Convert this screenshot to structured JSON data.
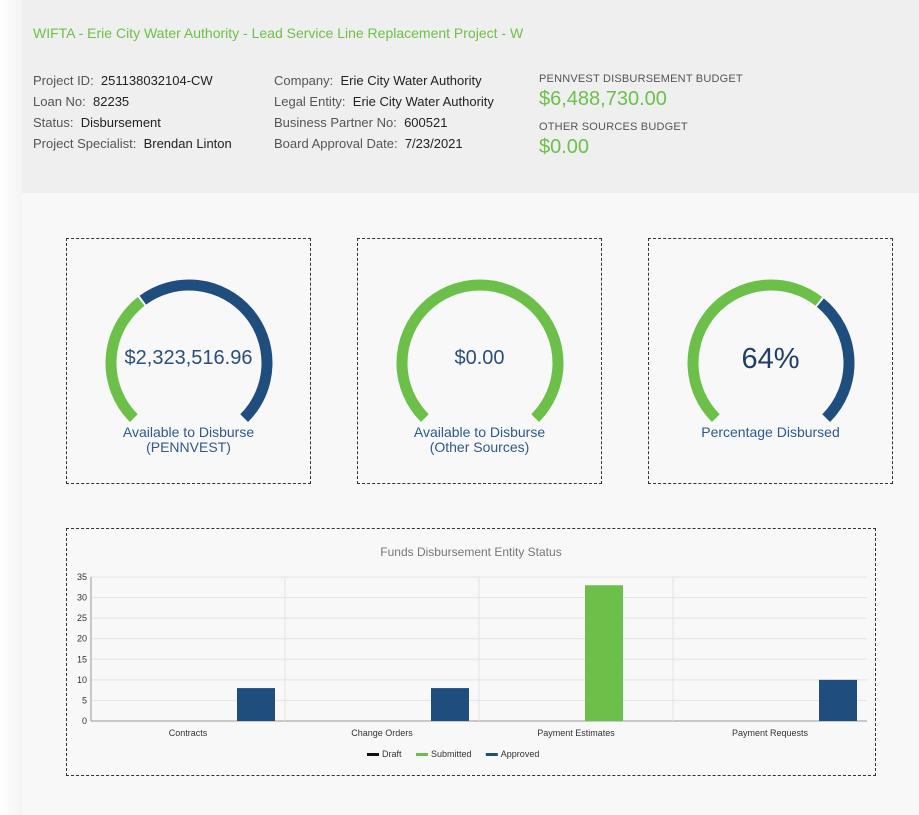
{
  "project": {
    "title": "WIFTA - Erie City Water Authority - Lead Service Line Replacement Project - W",
    "col1": [
      {
        "label": "Project ID:",
        "value": "251138032104-CW"
      },
      {
        "label": "Loan No:",
        "value": "82235"
      },
      {
        "label": "Status:",
        "value": "Disbursement"
      },
      {
        "label": "Project Specialist:",
        "value": "Brendan Linton"
      }
    ],
    "col2": [
      {
        "label": "Company:",
        "value": "Erie City Water Authority"
      },
      {
        "label": "Legal Entity:",
        "value": "Erie City Water Authority"
      },
      {
        "label": "Business Partner No:",
        "value": "600521"
      },
      {
        "label": "Board Approval Date:",
        "value": "7/23/2021"
      }
    ],
    "budgets": {
      "pennvest_label": "PENNVEST DISBURSEMENT BUDGET",
      "pennvest_value": "$6,488,730.00",
      "other_label": "OTHER SOURCES BUDGET",
      "other_value": "$0.00"
    }
  },
  "gauges": [
    {
      "value": "$2,323,516.96",
      "caption_line1": "Available to Disburse",
      "caption_line2": "(PENNVEST)",
      "fraction": 0.36
    },
    {
      "value": "$0.00",
      "caption_line1": "Available to Disburse",
      "caption_line2": "(Other Sources)",
      "fraction": 1.0
    },
    {
      "value": "64%",
      "caption_line1": "Percentage Disbursed",
      "caption_line2": "",
      "fraction": 0.64
    }
  ],
  "colors": {
    "green": "#6cc04a",
    "navy": "#1f4e7e",
    "draft": "#111111"
  },
  "chart_data": {
    "type": "bar",
    "title": "Funds Disbursement Entity Status",
    "categories": [
      "Contracts",
      "Change Orders",
      "Payment Estimates",
      "Payment Requests"
    ],
    "series": [
      {
        "name": "Draft",
        "values": [
          0,
          0,
          0,
          0
        ],
        "color": "#111111"
      },
      {
        "name": "Submitted",
        "values": [
          0,
          0,
          33,
          0
        ],
        "color": "#6cc04a"
      },
      {
        "name": "Approved",
        "values": [
          8,
          8,
          0,
          10
        ],
        "color": "#1f4e7e"
      }
    ],
    "ylim": [
      0,
      35
    ],
    "yticks": [
      0,
      5,
      10,
      15,
      20,
      25,
      30,
      35
    ],
    "grid": true,
    "legend": "bottom"
  }
}
